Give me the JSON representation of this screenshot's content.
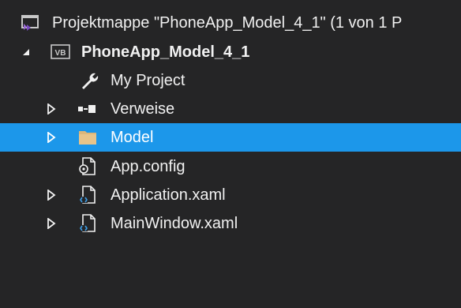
{
  "solution": {
    "title": "Projektmappe \"PhoneApp_Model_4_1\" (1 von 1 P"
  },
  "project": {
    "name": "PhoneApp_Model_4_1",
    "badge": "VB"
  },
  "items": [
    {
      "label": "My Project",
      "icon": "wrench-icon"
    },
    {
      "label": "Verweise",
      "icon": "references-icon"
    },
    {
      "label": "Model",
      "icon": "folder-icon",
      "selected": true
    },
    {
      "label": "App.config",
      "icon": "config-file-icon"
    },
    {
      "label": "Application.xaml",
      "icon": "xaml-file-icon"
    },
    {
      "label": "MainWindow.xaml",
      "icon": "xaml-file-icon"
    }
  ],
  "colors": {
    "background": "#252526",
    "selection": "#1c97ea",
    "text": "#f1f1f1"
  }
}
